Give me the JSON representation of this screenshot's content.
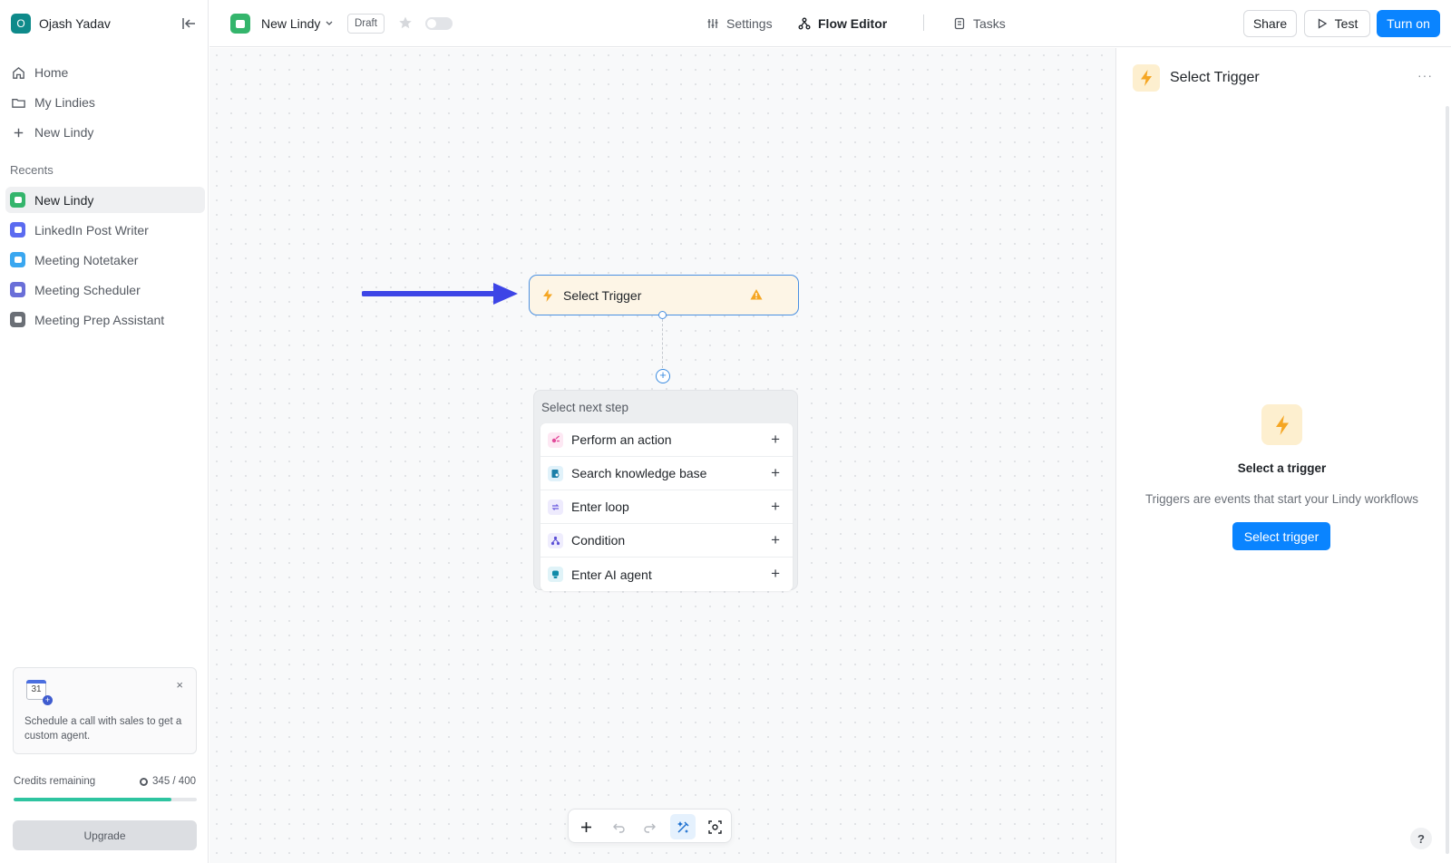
{
  "sidebar": {
    "workspace": {
      "initial": "O",
      "name": "Ojash Yadav"
    },
    "nav": [
      {
        "label": "Home",
        "icon": "home-icon"
      },
      {
        "label": "My Lindies",
        "icon": "folder-icon"
      },
      {
        "label": "New Lindy",
        "icon": "plus-icon"
      }
    ],
    "recents_label": "Recents",
    "recents": [
      {
        "label": "New Lindy",
        "color": "#34b56c",
        "active": true
      },
      {
        "label": "LinkedIn Post Writer",
        "color": "#5b6bf0"
      },
      {
        "label": "Meeting Notetaker",
        "color": "#3aa7f0"
      },
      {
        "label": "Meeting Scheduler",
        "color": "#6a6fd8"
      },
      {
        "label": "Meeting Prep Assistant",
        "color": "#6b6f76"
      }
    ],
    "promo": {
      "calendar_day": "31",
      "text": "Schedule a call with sales to get a custom agent.",
      "close": "×"
    },
    "credits": {
      "label": "Credits remaining",
      "value_text": "345 / 400",
      "used": 345,
      "total": 400,
      "fill_fraction": 0.8625
    },
    "upgrade_label": "Upgrade"
  },
  "topbar": {
    "agent_name": "New Lindy",
    "status_badge": "Draft",
    "tabs": [
      {
        "label": "Settings",
        "icon": "settings-icon"
      },
      {
        "label": "Flow Editor",
        "icon": "flow-icon",
        "active": true
      },
      {
        "label": "Tasks",
        "icon": "tasks-icon"
      }
    ],
    "share_label": "Share",
    "test_label": "Test",
    "turn_on_label": "Turn on"
  },
  "canvas": {
    "trigger_node": {
      "label": "Select Trigger",
      "status": "warning"
    },
    "next_step": {
      "title": "Select next step",
      "items": [
        {
          "label": "Perform an action",
          "icon": "action-icon",
          "color": "#e24a9a",
          "bg": "#fde8f3"
        },
        {
          "label": "Search knowledge base",
          "icon": "knowledge-base-icon",
          "color": "#1b7fa8",
          "bg": "#e1f2fa"
        },
        {
          "label": "Enter loop",
          "icon": "loop-icon",
          "color": "#6a5ae0",
          "bg": "#eeebfd"
        },
        {
          "label": "Condition",
          "icon": "condition-icon",
          "color": "#5b4fd6",
          "bg": "#efedfd"
        },
        {
          "label": "Enter AI agent",
          "icon": "ai-agent-icon",
          "color": "#0f8aa8",
          "bg": "#e0f3f8"
        }
      ]
    },
    "toolbar": [
      "add-node-icon",
      "undo-icon",
      "redo-icon",
      "auto-layout-icon",
      "focus-icon"
    ]
  },
  "right_panel": {
    "title": "Select Trigger",
    "more": "···",
    "empty_title": "Select a trigger",
    "empty_desc": "Triggers are events that start your Lindy workflows",
    "button_label": "Select trigger",
    "help_label": "?"
  },
  "colors": {
    "primary": "#0a84ff",
    "trigger_bg": "#fdf5e6",
    "bolt": "#f5a623",
    "credits": "#2ec4a0"
  }
}
